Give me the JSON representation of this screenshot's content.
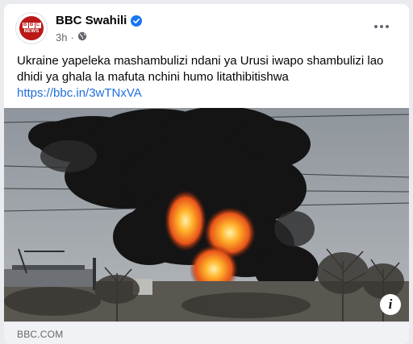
{
  "post": {
    "page_name": "BBC Swahili",
    "avatar_logo_letters": [
      "B",
      "B",
      "C"
    ],
    "avatar_logo_subtitle": "NEWS",
    "time": "3h",
    "separator": "·",
    "privacy_icon": "globe-icon",
    "verified_icon": "verified-badge-icon",
    "more_icon": "more-options-icon",
    "text": "Ukraine yapeleka mashambulizi ndani ya Urusi iwapo shambulizi lao dhidi ya ghala  la mafuta nchini humo  litathibitishwa",
    "link": "https://bbc.in/3wTNxVA"
  },
  "link_preview": {
    "image_description_icon": "info-icon",
    "info_glyph": "i",
    "domain": "BBC.COM"
  },
  "colors": {
    "accent": "#1877f2",
    "link": "#216fdb",
    "brand_red": "#bb1919",
    "secondary_text": "#65676b"
  }
}
